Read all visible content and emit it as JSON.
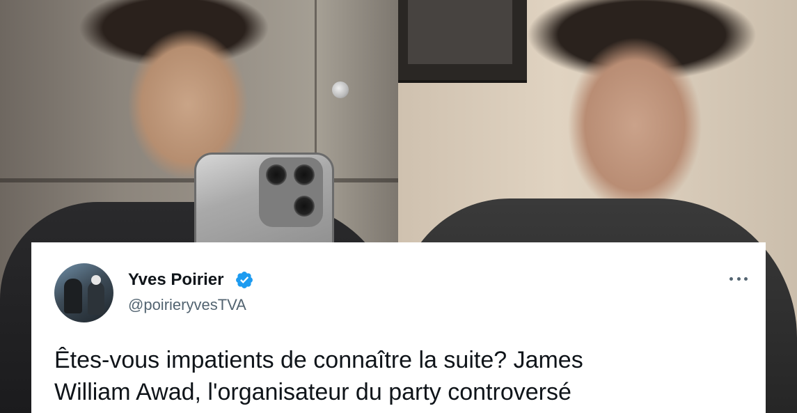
{
  "photos": {
    "left_alt": "Man with curly hair taking a mirror selfie with a phone",
    "right_alt": "Man with curly hair speaking in a video"
  },
  "tweet": {
    "display_name": "Yves Poirier",
    "handle": "@poirieryvesTVA",
    "verified": true,
    "text_lines": [
      "Êtes-vous impatients de connaître la suite? James",
      "William Awad, l'organisateur du party controversé"
    ],
    "colors": {
      "card_bg": "#ffffff",
      "name": "#0f1419",
      "handle": "#536471",
      "verified_badge": "#1d9bf0"
    },
    "icons": {
      "verified": "verified-badge-icon",
      "more": "more-options-icon"
    }
  }
}
